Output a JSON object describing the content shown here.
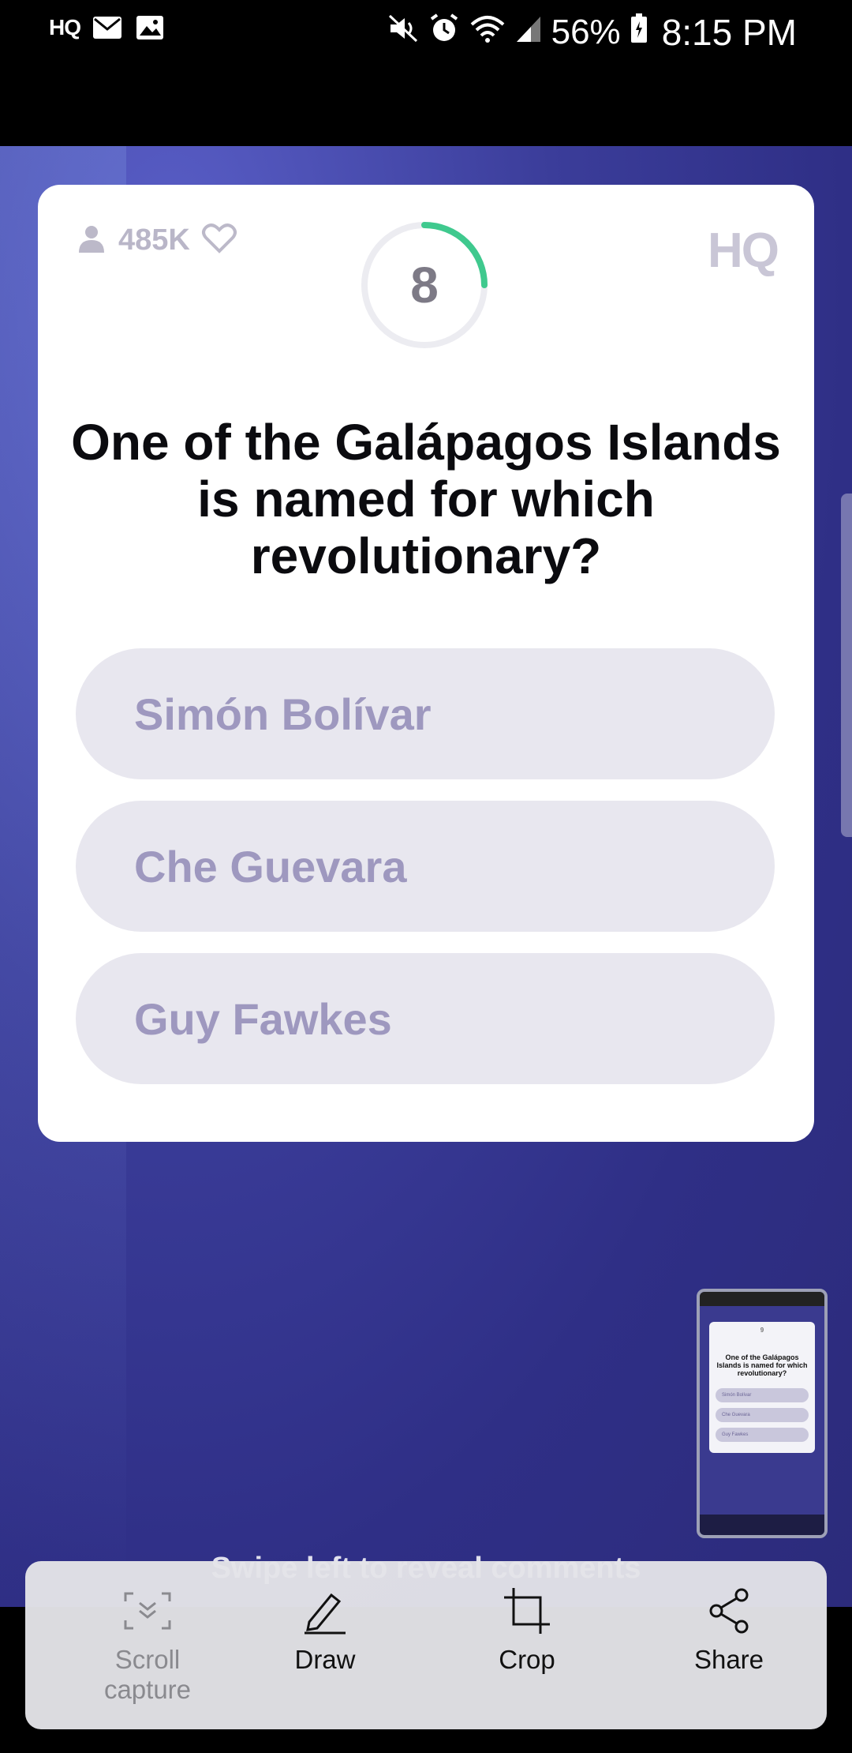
{
  "status_bar": {
    "left_app_label": "HQ",
    "battery_percent": "56%",
    "time": "8:15 PM"
  },
  "card": {
    "viewers": "485K",
    "timer": "8",
    "timer_progress": 0.25,
    "logo": "HQ",
    "question": "One of the Galápagos Islands is named for which revolutionary?",
    "answers": [
      {
        "label": "Simón Bolívar"
      },
      {
        "label": "Che Guevara"
      },
      {
        "label": "Guy Fawkes"
      }
    ]
  },
  "thumbnail": {
    "timer": "9",
    "question": "One of the Galápagos Islands is named for which revolutionary?",
    "answers": [
      "Simón Bolívar",
      "Che Guevara",
      "Guy Fawkes"
    ]
  },
  "overlay_hint": "Swipe left to reveal comments",
  "toolbar": {
    "items": [
      {
        "label": "Scroll capture",
        "icon": "scroll-capture-icon",
        "enabled": false
      },
      {
        "label": "Draw",
        "icon": "pencil-icon",
        "enabled": true
      },
      {
        "label": "Crop",
        "icon": "crop-icon",
        "enabled": true
      },
      {
        "label": "Share",
        "icon": "share-icon",
        "enabled": true
      }
    ]
  },
  "colors": {
    "accent_timer": "#3fc98e",
    "app_background": "#2f2f86",
    "answer_bg": "#e8e7ef",
    "answer_text": "#9e98bf"
  }
}
